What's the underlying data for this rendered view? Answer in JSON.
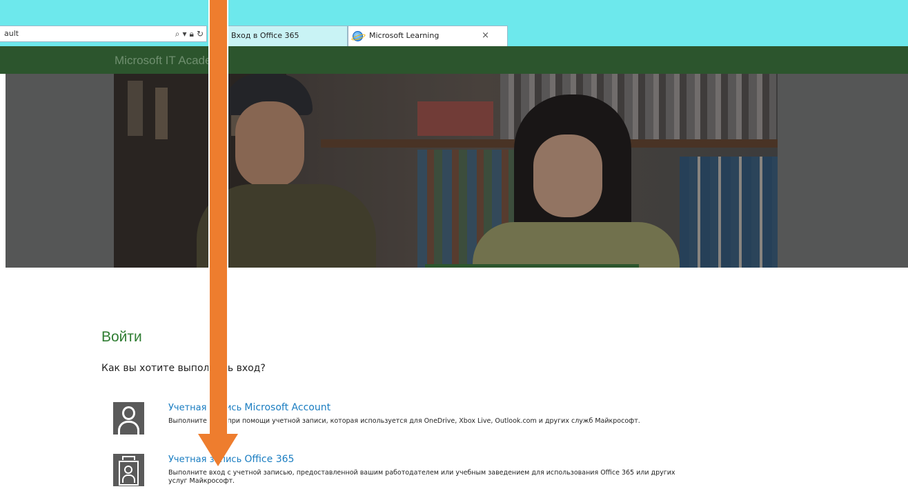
{
  "browser": {
    "address_text": "ault",
    "address_icons": [
      "search-icon",
      "dropdown-icon",
      "lock-icon",
      "refresh-icon"
    ],
    "tabs": [
      {
        "label": "Вход в Office 365",
        "active": false
      },
      {
        "label": "Microsoft Learning",
        "active": true
      }
    ],
    "close_glyph": "×"
  },
  "site": {
    "title": "Microsoft IT Academy"
  },
  "signin": {
    "heading": "Войти",
    "prompt": "Как вы хотите выполнить вход?",
    "options": [
      {
        "icon": "person-icon",
        "link_prefix": "Учетная запись ",
        "link_strong": "Microsoft Account",
        "description": "Выполните вход при помощи учетной записи, которая используется для OneDrive, Xbox Live, Outlook.com и других служб Майкрософт."
      },
      {
        "icon": "badge-icon",
        "link_prefix": "Учетная запись ",
        "link_strong": "Office 365",
        "description": "Выполните вход с учетной записью, предоставленной вашим работодателем или учебным заведением для использования Office 365 или других услуг Майкрософт."
      }
    ]
  },
  "colors": {
    "browser_frame": "#6de8ec",
    "site_header": "#2c552d",
    "heading_green": "#2f7d32",
    "link_blue": "#1a7dc1",
    "annotation_arrow": "#ee7d2e"
  }
}
